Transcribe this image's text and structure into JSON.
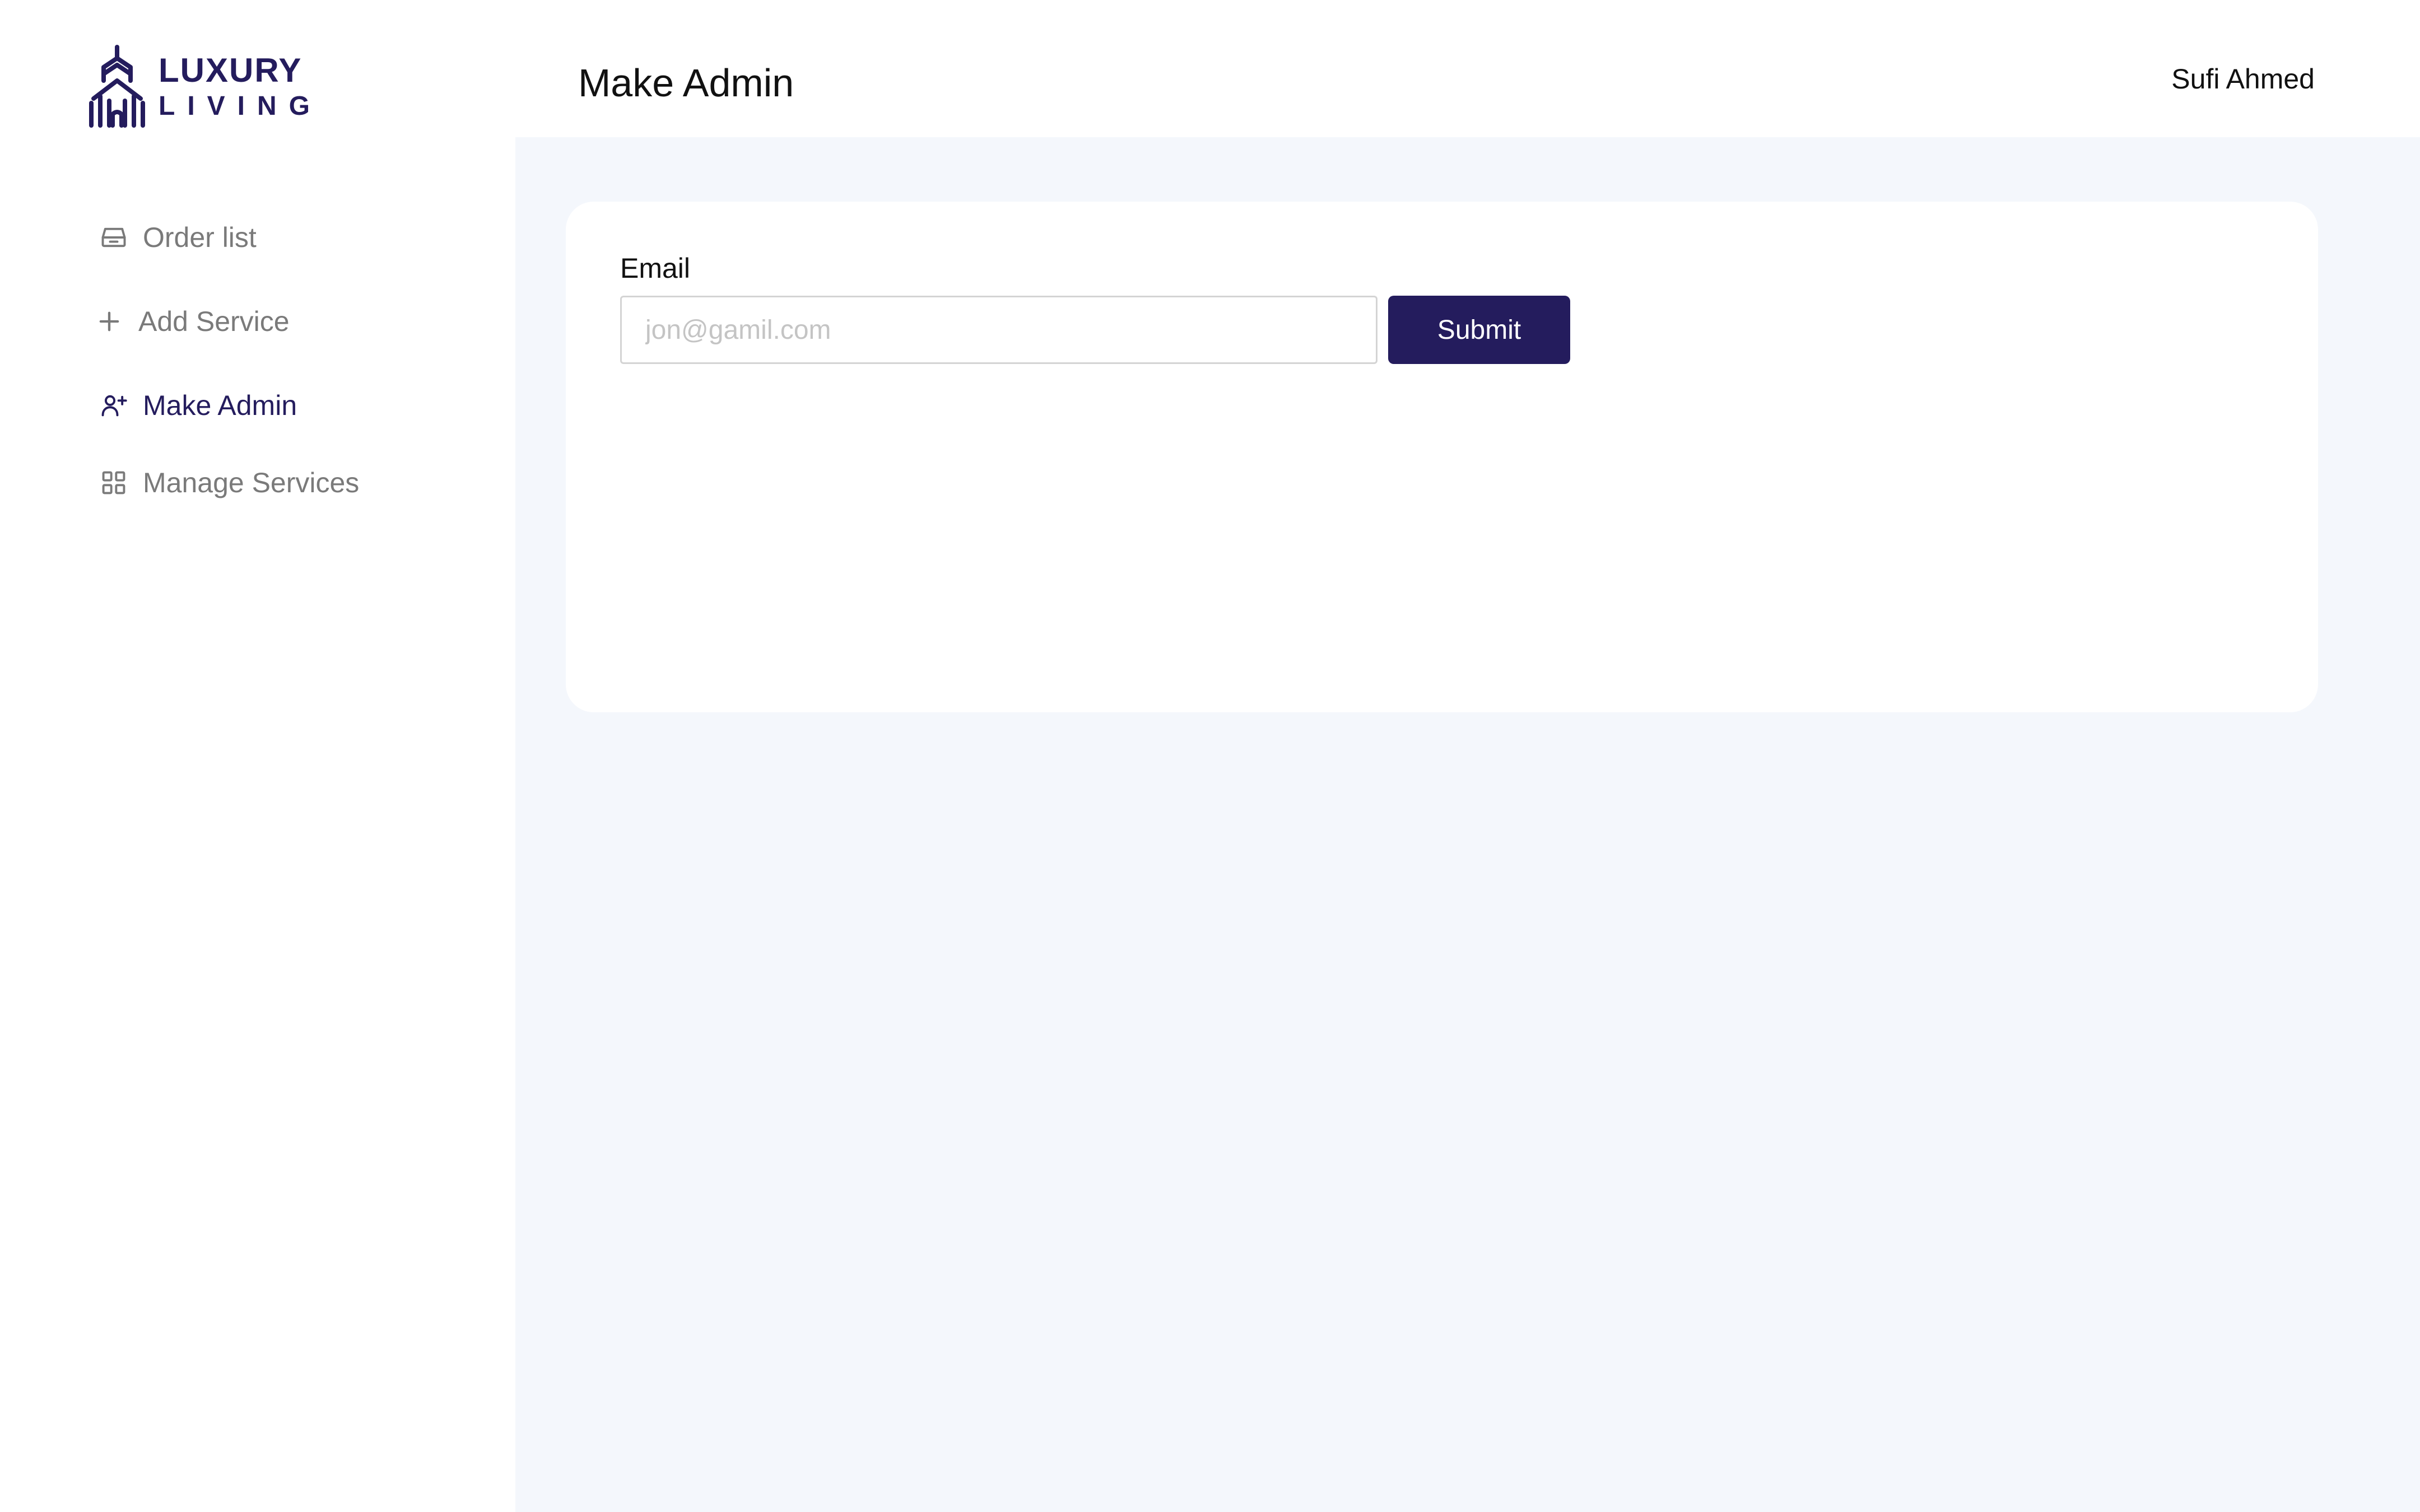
{
  "brand": {
    "line1": "LUXURY",
    "line2": "LIVING",
    "color": "#241c5d"
  },
  "sidebar": {
    "items": [
      {
        "label": "Order list",
        "icon": "inbox-icon",
        "active": false
      },
      {
        "label": "Add Service",
        "icon": "plus-icon",
        "active": false
      },
      {
        "label": "Make Admin",
        "icon": "user-plus-icon",
        "active": true
      },
      {
        "label": "Manage Services",
        "icon": "grid-icon",
        "active": false
      }
    ]
  },
  "header": {
    "title": "Make Admin",
    "user_name": "Sufi Ahmed"
  },
  "form": {
    "email_label": "Email",
    "email_placeholder": "jon@gamil.com",
    "email_value": "",
    "submit_label": "Submit"
  },
  "colors": {
    "accent": "#241c5d",
    "background": "#f4f7fc",
    "inactive_text": "#7a7a7a"
  }
}
